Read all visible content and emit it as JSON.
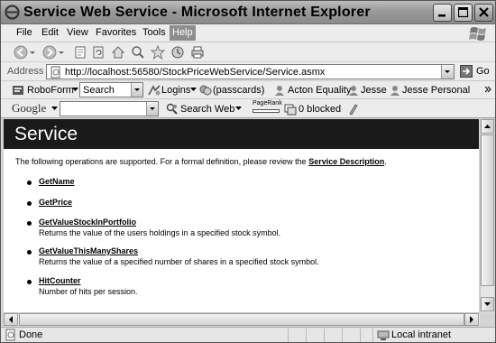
{
  "window": {
    "title": "Service Web Service - Microsoft Internet Explorer"
  },
  "menu": {
    "items": [
      "File",
      "Edit",
      "View",
      "Favorites",
      "Tools",
      "Help"
    ]
  },
  "address": {
    "label": "Address",
    "url": "http://localhost:56580/StockPriceWebService/Service.asmx",
    "go_label": "Go"
  },
  "roboform": {
    "brand": "RoboForm",
    "search_value": "Search",
    "logins_label": "Logins",
    "passcards_label": "(passcards)",
    "identities": [
      "Acton Equality",
      "Jesse",
      "Jesse Personal"
    ]
  },
  "google": {
    "brand": "Google",
    "search_web_label": "Search Web",
    "pagerank_label": "PageRank",
    "blocked_label": "0 blocked"
  },
  "page": {
    "title": "Service",
    "intro": "The following operations are supported. For a formal definition, please review the ",
    "intro_link": "Service Description",
    "intro_end": ".",
    "operations": [
      {
        "name": "GetName",
        "description": ""
      },
      {
        "name": "GetPrice",
        "description": ""
      },
      {
        "name": "GetValueStockInPortfolio",
        "description": "Returns the value of the users holdings in a specified stock symbol."
      },
      {
        "name": "GetValueThisManyShares",
        "description": "Returns the value of a specified number of shares in a specified stock symbol."
      },
      {
        "name": "HitCounter",
        "description": "Number of hits per session."
      }
    ]
  },
  "status": {
    "text": "Done",
    "zone": "Local intranet"
  },
  "colors": {
    "page_header_bg": "#1a1a1a",
    "chrome": "#ececec"
  }
}
